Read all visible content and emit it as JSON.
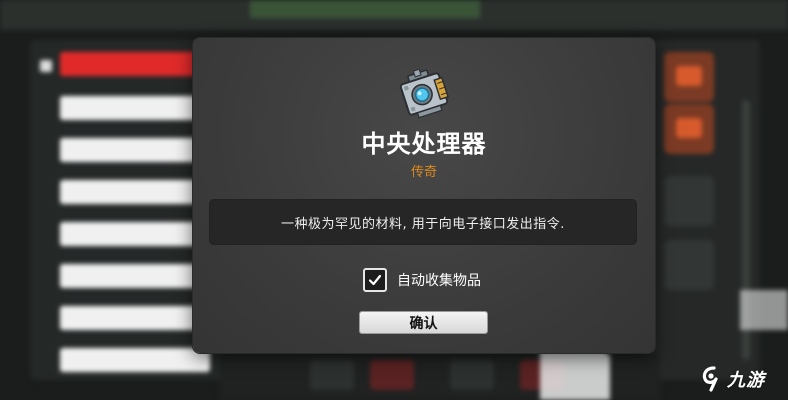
{
  "dialog": {
    "item_name": "中央处理器",
    "rarity": "传奇",
    "description": "一种极为罕见的材料, 用于向电子接口发出指令.",
    "auto_collect_label": "自动收集物品",
    "auto_collect_checked": true,
    "confirm_label": "确认",
    "item_icon": "cpu-chip-icon"
  },
  "watermark": {
    "text": "九游",
    "icon": "jiuyou-logo-icon"
  },
  "colors": {
    "rarity_legendary": "#e08a1e",
    "dialog_bg": "#3d3d3d",
    "description_bg": "#262626",
    "accent_red": "#e02a2a"
  }
}
